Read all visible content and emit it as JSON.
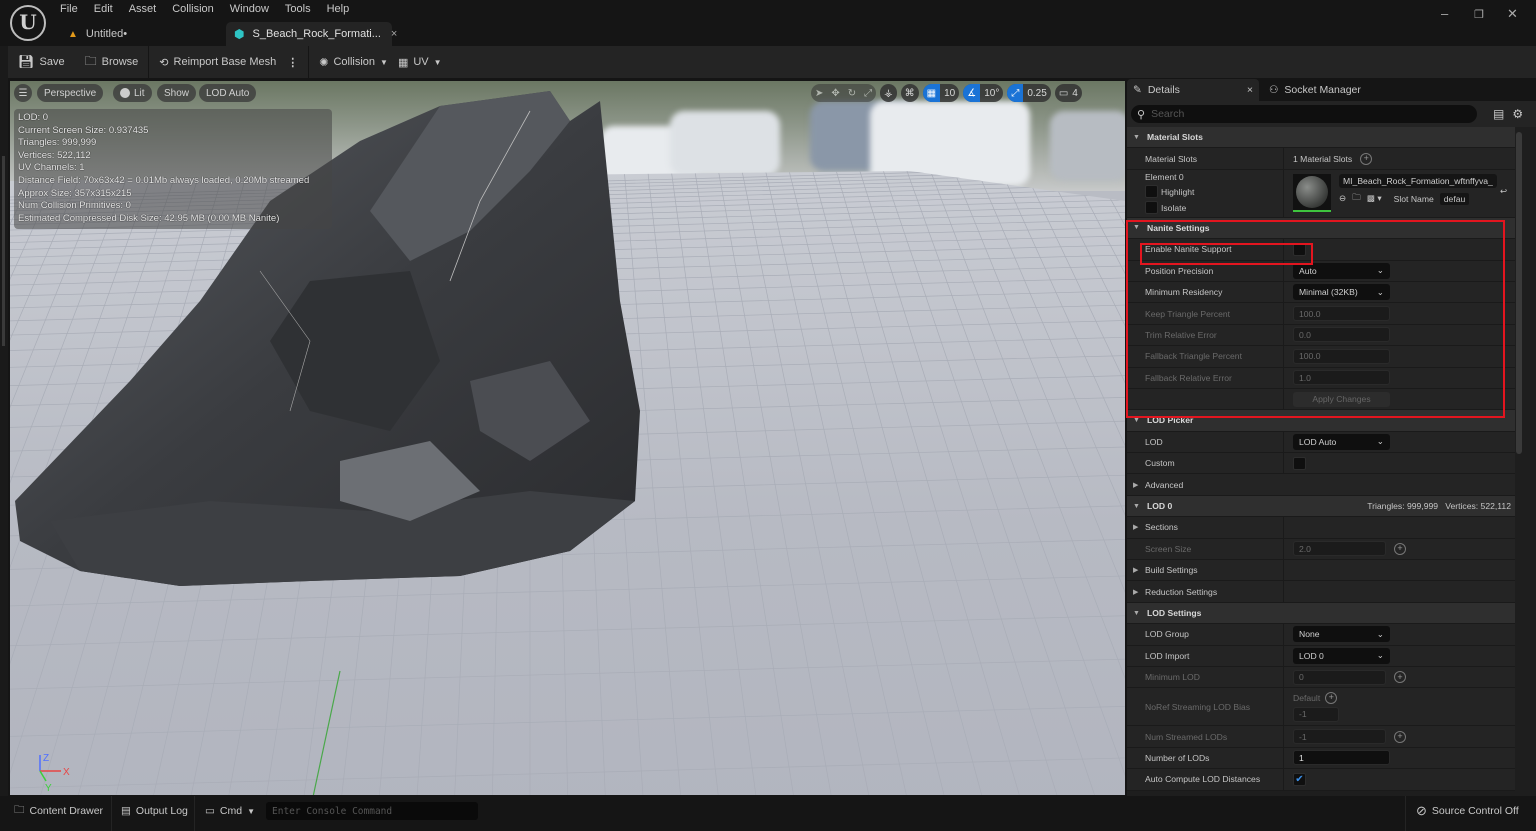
{
  "menu": [
    "File",
    "Edit",
    "Asset",
    "Collision",
    "Window",
    "Tools",
    "Help"
  ],
  "tabs": {
    "level": "Untitled•",
    "asset": "S_Beach_Rock_Formati...",
    "close": "×"
  },
  "window_controls": {
    "minimize": "–",
    "restore": "❐",
    "close": "✕"
  },
  "toolbar": {
    "save": "Save",
    "browse": "Browse",
    "reimport": "Reimport Base Mesh",
    "more": "⋮",
    "collision": "Collision",
    "uv": "UV"
  },
  "viewport": {
    "view_mode": "Perspective",
    "lighting": "Lit",
    "show": "Show",
    "lod": "LOD Auto",
    "grid_snap": "10",
    "rotation_snap": "10°",
    "scale_snap": "0.25",
    "camera_speed": "4",
    "stats": [
      "LOD:  0",
      "Current Screen Size:  0.937435",
      "Triangles:  999,999",
      "Vertices:  522,112",
      "UV Channels:  1",
      "Distance Field:  70x63x42 = 0.01Mb always loaded, 0.20Mb streamed",
      "Approx Size: 357x315x215",
      "Num Collision Primitives:  0",
      "Estimated Compressed Disk Size: 42.95 MB (0.00 MB Nanite)"
    ],
    "axes": {
      "x": "X",
      "y": "Y",
      "z": "Z"
    }
  },
  "details": {
    "tab_details": "Details",
    "tab_close": "×",
    "tab_socket": "Socket Manager",
    "search_placeholder": "Search",
    "material_slots": {
      "header": "Material Slots",
      "label": "Material Slots",
      "count": "1 Material Slots",
      "element": "Element 0",
      "highlight": "Highlight",
      "isolate": "Isolate",
      "material_name": "MI_Beach_Rock_Formation_wftnffyva_",
      "slot_name_label": "Slot Name",
      "slot_name_value": "defau"
    },
    "nanite": {
      "header": "Nanite Settings",
      "enable_label": "Enable Nanite Support",
      "enable_checked": false,
      "position_precision_label": "Position Precision",
      "position_precision": "Auto",
      "min_residency_label": "Minimum Residency",
      "min_residency": "Minimal (32KB)",
      "keep_tri_label": "Keep Triangle Percent",
      "keep_tri": "100.0",
      "trim_err_label": "Trim Relative Error",
      "trim_err": "0.0",
      "fallback_tri_label": "Fallback Triangle Percent",
      "fallback_tri": "100.0",
      "fallback_err_label": "Fallback Relative Error",
      "fallback_err": "1.0",
      "apply": "Apply Changes"
    },
    "lod_picker": {
      "header": "LOD Picker",
      "lod_label": "LOD",
      "lod_value": "LOD Auto",
      "custom_label": "Custom",
      "advanced": "Advanced"
    },
    "lod0": {
      "header": "LOD 0",
      "summary": "Triangles: 999,999   Vertices: 522,112",
      "sections": "Sections",
      "screen_size_label": "Screen Size",
      "screen_size": "2.0",
      "build_settings": "Build Settings",
      "reduction_settings": "Reduction Settings"
    },
    "lod_settings": {
      "header": "LOD Settings",
      "group_label": "LOD Group",
      "group": "None",
      "import_label": "LOD Import",
      "import": "LOD 0",
      "min_lod_label": "Minimum LOD",
      "min_lod": "0",
      "noref_label": "NoRef Streaming LOD Bias",
      "noref_default": "Default",
      "noref_value": "-1",
      "num_streamed_label": "Num Streamed LODs",
      "num_streamed": "-1",
      "num_lods_label": "Number of LODs",
      "num_lods": "1",
      "auto_compute_label": "Auto Compute LOD Distances",
      "auto_compute_checked": true
    }
  },
  "statusbar": {
    "content_drawer": "Content Drawer",
    "output_log": "Output Log",
    "cmd": "Cmd",
    "console_placeholder": "Enter Console Command",
    "source_control": "Source Control Off"
  },
  "colors": {
    "accent": "#1a73d6",
    "highlight_box": "#e3151f",
    "panel": "#242424"
  }
}
